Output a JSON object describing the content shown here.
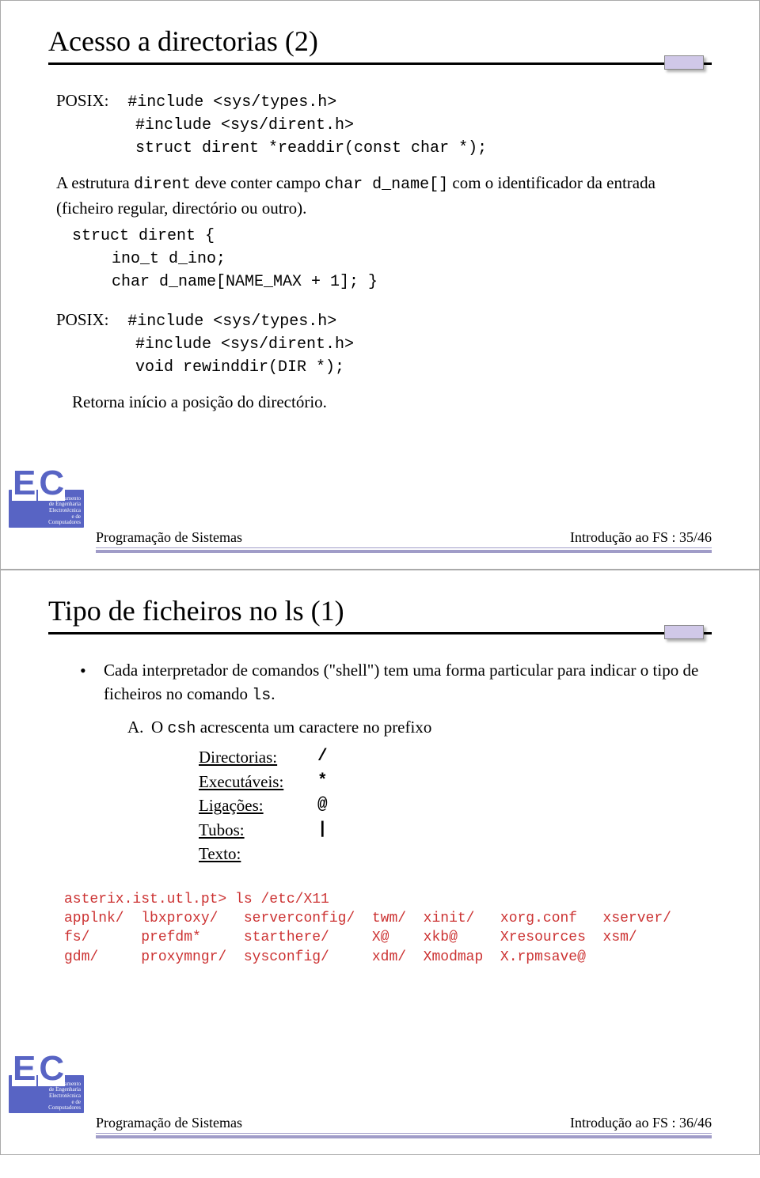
{
  "slide1": {
    "title": "Acesso a directorias (2)",
    "posix_label": "POSIX:",
    "inc1": "#include <sys/types.h>",
    "inc2": "#include <sys/dirent.h>",
    "func1": "struct dirent *readdir(const char *);",
    "para1_a": "A estrutura ",
    "para1_code1": "dirent",
    "para1_b": " deve conter campo ",
    "para1_code2": "char d_name[]",
    "para1_c": " com o identificador da entrada (ficheiro regular, directório ou outro).",
    "struct1": "struct dirent {",
    "struct2": "ino_t d_ino;",
    "struct3": "char d_name[NAME_MAX + 1]; }",
    "inc3": "#include <sys/types.h>",
    "inc4": "#include <sys/dirent.h>",
    "func2": "void rewinddir(DIR *);",
    "para2": "Retorna início a posição do directório.",
    "footer_left": "Programação de Sistemas",
    "footer_right": "Introdução ao FS : 35/46"
  },
  "slide2": {
    "title": "Tipo de ficheiros no ls (1)",
    "bullet_a": "Cada interpretador de comandos (\"shell\") tem uma forma particular para indicar o tipo de ficheiros no comando ",
    "bullet_code": "ls",
    "bullet_dot": ".",
    "sub_a_a": "O ",
    "sub_a_code": "csh",
    "sub_a_b": " acrescenta um caractere no prefixo",
    "prefixes": {
      "dir_l": "Directorias:",
      "dir_s": "/",
      "exe_l": "Executáveis:",
      "exe_s": "*",
      "lig_l": "Ligações:",
      "lig_s": "@",
      "tub_l": "Tubos:",
      "tub_s": "|",
      "tex_l": "Texto:"
    },
    "terminal": "asterix.ist.utl.pt> ls /etc/X11\napplnk/  lbxproxy/   serverconfig/  twm/  xinit/   xorg.conf   xserver/\nfs/      prefdm*     starthere/     X@    xkb@     Xresources  xsm/\ngdm/     proxymngr/  sysconfig/     xdm/  Xmodmap  X.rpmsave@",
    "footer_left": "Programação de Sistemas",
    "footer_right": "Introdução ao FS : 36/46"
  },
  "badge": {
    "l1": "Departamento",
    "l2": "de Engenharia",
    "l3": "Electrotécnica",
    "l4": "e de",
    "l5": "Computadores"
  }
}
